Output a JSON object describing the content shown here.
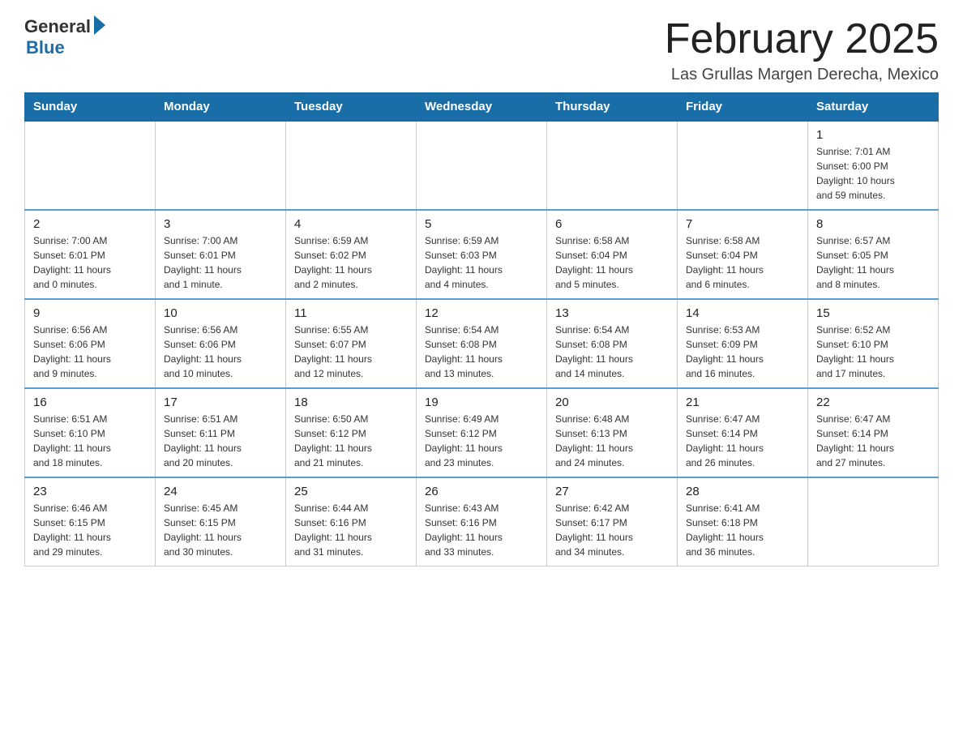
{
  "logo": {
    "general": "General",
    "blue": "Blue"
  },
  "header": {
    "title": "February 2025",
    "location": "Las Grullas Margen Derecha, Mexico"
  },
  "weekdays": [
    "Sunday",
    "Monday",
    "Tuesday",
    "Wednesday",
    "Thursday",
    "Friday",
    "Saturday"
  ],
  "weeks": [
    [
      {
        "day": "",
        "info": ""
      },
      {
        "day": "",
        "info": ""
      },
      {
        "day": "",
        "info": ""
      },
      {
        "day": "",
        "info": ""
      },
      {
        "day": "",
        "info": ""
      },
      {
        "day": "",
        "info": ""
      },
      {
        "day": "1",
        "info": "Sunrise: 7:01 AM\nSunset: 6:00 PM\nDaylight: 10 hours\nand 59 minutes."
      }
    ],
    [
      {
        "day": "2",
        "info": "Sunrise: 7:00 AM\nSunset: 6:01 PM\nDaylight: 11 hours\nand 0 minutes."
      },
      {
        "day": "3",
        "info": "Sunrise: 7:00 AM\nSunset: 6:01 PM\nDaylight: 11 hours\nand 1 minute."
      },
      {
        "day": "4",
        "info": "Sunrise: 6:59 AM\nSunset: 6:02 PM\nDaylight: 11 hours\nand 2 minutes."
      },
      {
        "day": "5",
        "info": "Sunrise: 6:59 AM\nSunset: 6:03 PM\nDaylight: 11 hours\nand 4 minutes."
      },
      {
        "day": "6",
        "info": "Sunrise: 6:58 AM\nSunset: 6:04 PM\nDaylight: 11 hours\nand 5 minutes."
      },
      {
        "day": "7",
        "info": "Sunrise: 6:58 AM\nSunset: 6:04 PM\nDaylight: 11 hours\nand 6 minutes."
      },
      {
        "day": "8",
        "info": "Sunrise: 6:57 AM\nSunset: 6:05 PM\nDaylight: 11 hours\nand 8 minutes."
      }
    ],
    [
      {
        "day": "9",
        "info": "Sunrise: 6:56 AM\nSunset: 6:06 PM\nDaylight: 11 hours\nand 9 minutes."
      },
      {
        "day": "10",
        "info": "Sunrise: 6:56 AM\nSunset: 6:06 PM\nDaylight: 11 hours\nand 10 minutes."
      },
      {
        "day": "11",
        "info": "Sunrise: 6:55 AM\nSunset: 6:07 PM\nDaylight: 11 hours\nand 12 minutes."
      },
      {
        "day": "12",
        "info": "Sunrise: 6:54 AM\nSunset: 6:08 PM\nDaylight: 11 hours\nand 13 minutes."
      },
      {
        "day": "13",
        "info": "Sunrise: 6:54 AM\nSunset: 6:08 PM\nDaylight: 11 hours\nand 14 minutes."
      },
      {
        "day": "14",
        "info": "Sunrise: 6:53 AM\nSunset: 6:09 PM\nDaylight: 11 hours\nand 16 minutes."
      },
      {
        "day": "15",
        "info": "Sunrise: 6:52 AM\nSunset: 6:10 PM\nDaylight: 11 hours\nand 17 minutes."
      }
    ],
    [
      {
        "day": "16",
        "info": "Sunrise: 6:51 AM\nSunset: 6:10 PM\nDaylight: 11 hours\nand 18 minutes."
      },
      {
        "day": "17",
        "info": "Sunrise: 6:51 AM\nSunset: 6:11 PM\nDaylight: 11 hours\nand 20 minutes."
      },
      {
        "day": "18",
        "info": "Sunrise: 6:50 AM\nSunset: 6:12 PM\nDaylight: 11 hours\nand 21 minutes."
      },
      {
        "day": "19",
        "info": "Sunrise: 6:49 AM\nSunset: 6:12 PM\nDaylight: 11 hours\nand 23 minutes."
      },
      {
        "day": "20",
        "info": "Sunrise: 6:48 AM\nSunset: 6:13 PM\nDaylight: 11 hours\nand 24 minutes."
      },
      {
        "day": "21",
        "info": "Sunrise: 6:47 AM\nSunset: 6:14 PM\nDaylight: 11 hours\nand 26 minutes."
      },
      {
        "day": "22",
        "info": "Sunrise: 6:47 AM\nSunset: 6:14 PM\nDaylight: 11 hours\nand 27 minutes."
      }
    ],
    [
      {
        "day": "23",
        "info": "Sunrise: 6:46 AM\nSunset: 6:15 PM\nDaylight: 11 hours\nand 29 minutes."
      },
      {
        "day": "24",
        "info": "Sunrise: 6:45 AM\nSunset: 6:15 PM\nDaylight: 11 hours\nand 30 minutes."
      },
      {
        "day": "25",
        "info": "Sunrise: 6:44 AM\nSunset: 6:16 PM\nDaylight: 11 hours\nand 31 minutes."
      },
      {
        "day": "26",
        "info": "Sunrise: 6:43 AM\nSunset: 6:16 PM\nDaylight: 11 hours\nand 33 minutes."
      },
      {
        "day": "27",
        "info": "Sunrise: 6:42 AM\nSunset: 6:17 PM\nDaylight: 11 hours\nand 34 minutes."
      },
      {
        "day": "28",
        "info": "Sunrise: 6:41 AM\nSunset: 6:18 PM\nDaylight: 11 hours\nand 36 minutes."
      },
      {
        "day": "",
        "info": ""
      }
    ]
  ]
}
